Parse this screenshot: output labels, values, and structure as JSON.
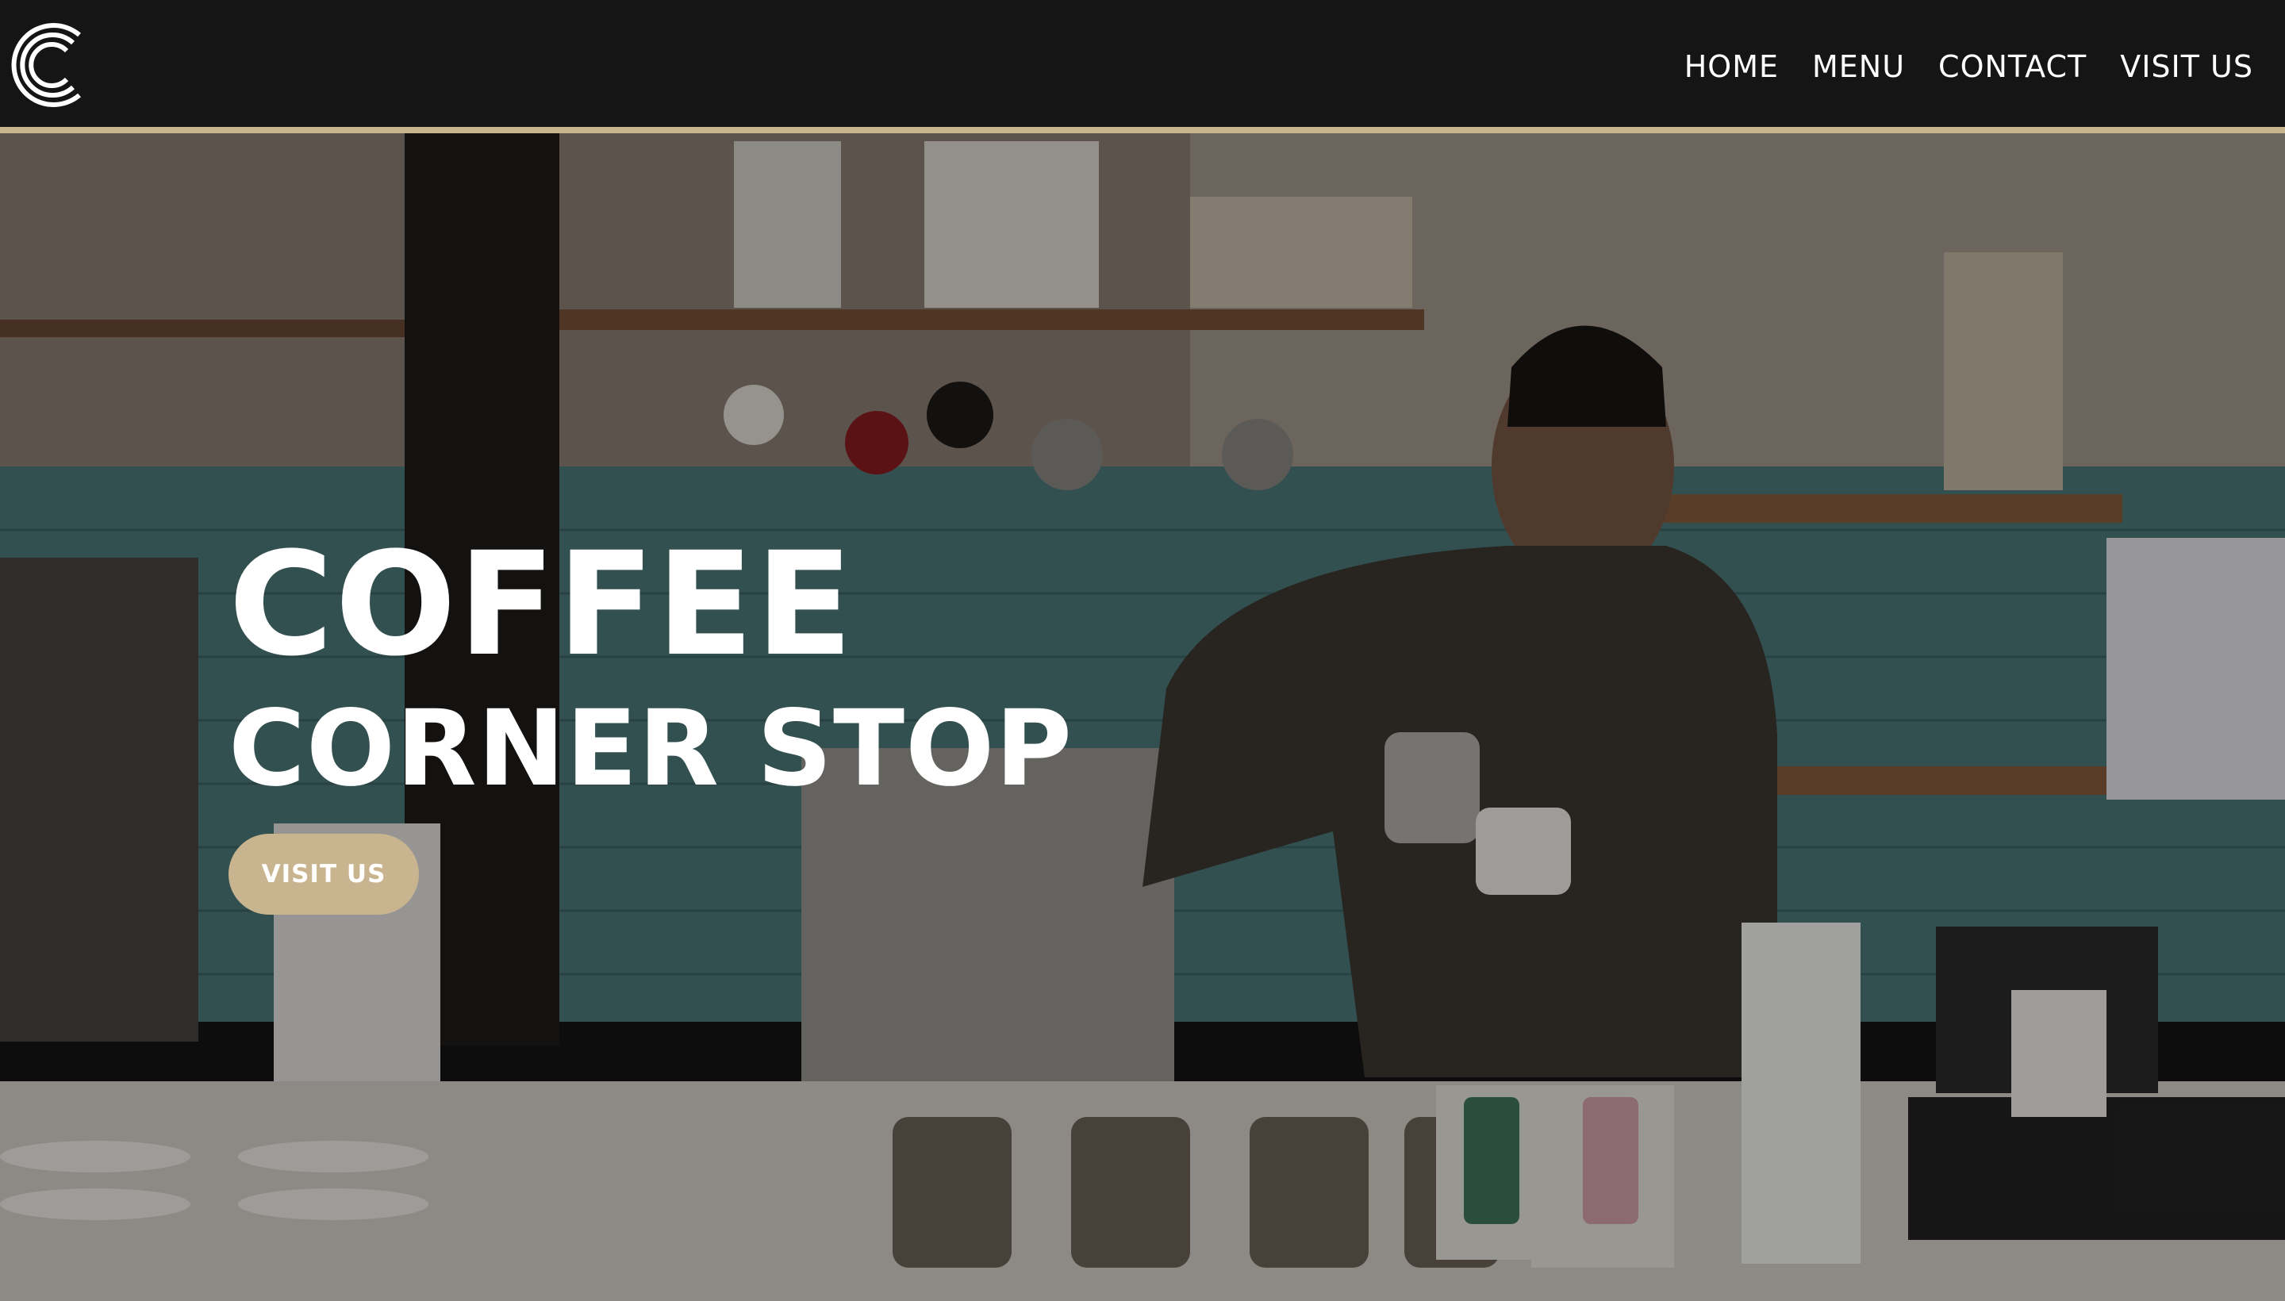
{
  "header": {
    "logo_icon": "c-rings-logo-icon",
    "nav": [
      {
        "label": "HOME"
      },
      {
        "label": "MENU"
      },
      {
        "label": "CONTACT"
      },
      {
        "label": "VISIT US"
      }
    ]
  },
  "hero": {
    "title_line1": "COFFEE",
    "title_line2": "CORNER STOP",
    "cta_label": "VISIT US",
    "image": "barista-pouring-coffee-photo"
  },
  "colors": {
    "topbar": "#151515",
    "accent": "#c8b48f",
    "text": "#ffffff"
  }
}
